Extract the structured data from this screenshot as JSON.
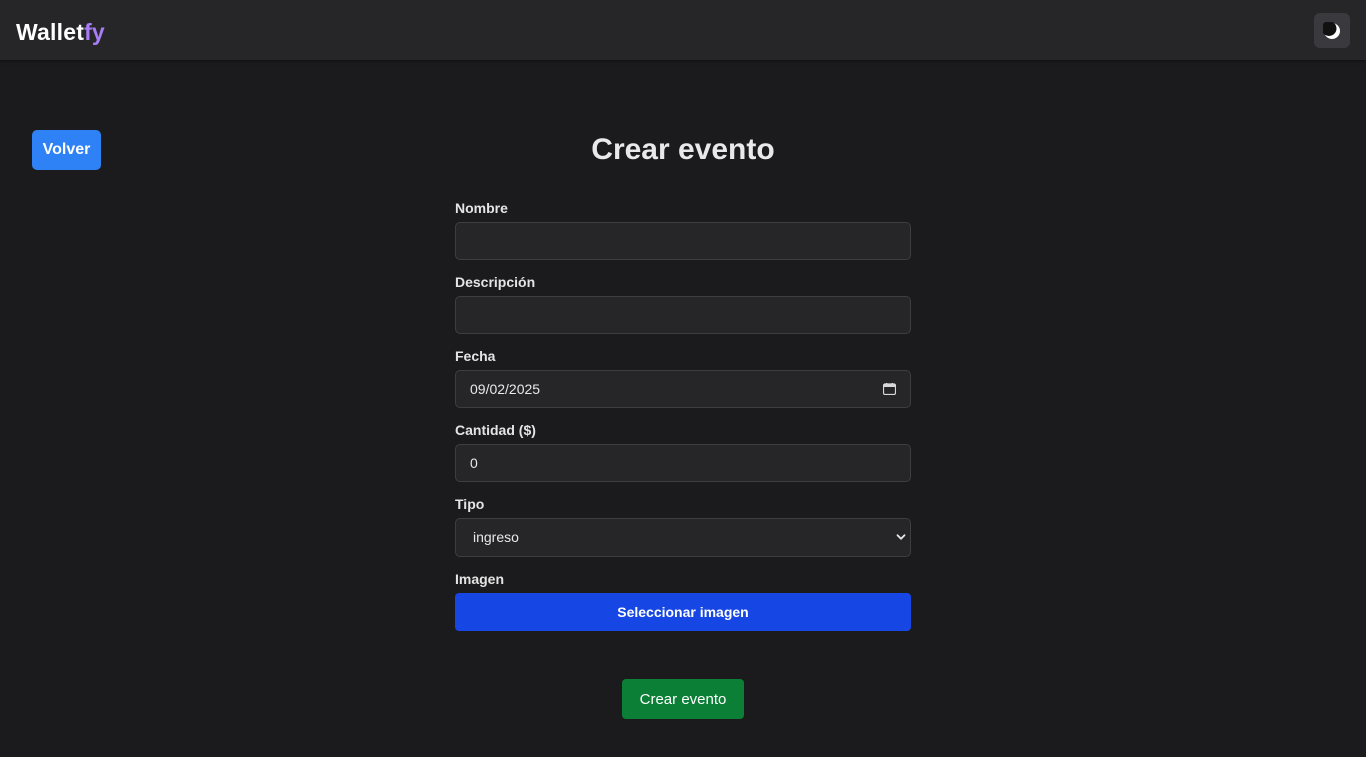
{
  "navbar": {
    "brand_main": "Wallet",
    "brand_accent": "fy",
    "theme_toggle_icon": "moon-icon",
    "accent_color": "#a77cf5"
  },
  "back_button": {
    "label": "Volver",
    "color": "#2e82f6"
  },
  "page_title": "Crear evento",
  "form": {
    "nombre": {
      "label": "Nombre",
      "value": ""
    },
    "descripcion": {
      "label": "Descripción",
      "value": ""
    },
    "fecha": {
      "label": "Fecha",
      "value": "09/02/2025",
      "icon": "calendar-icon"
    },
    "cantidad": {
      "label": "Cantidad ($)",
      "value": "0"
    },
    "tipo": {
      "label": "Tipo",
      "selected": "ingreso",
      "icon": "chevron-down-icon"
    },
    "imagen": {
      "label": "Imagen",
      "button_label": "Seleccionar imagen",
      "button_color": "#1646e4"
    }
  },
  "submit_button": {
    "label": "Crear evento",
    "color": "#0b7f35"
  }
}
